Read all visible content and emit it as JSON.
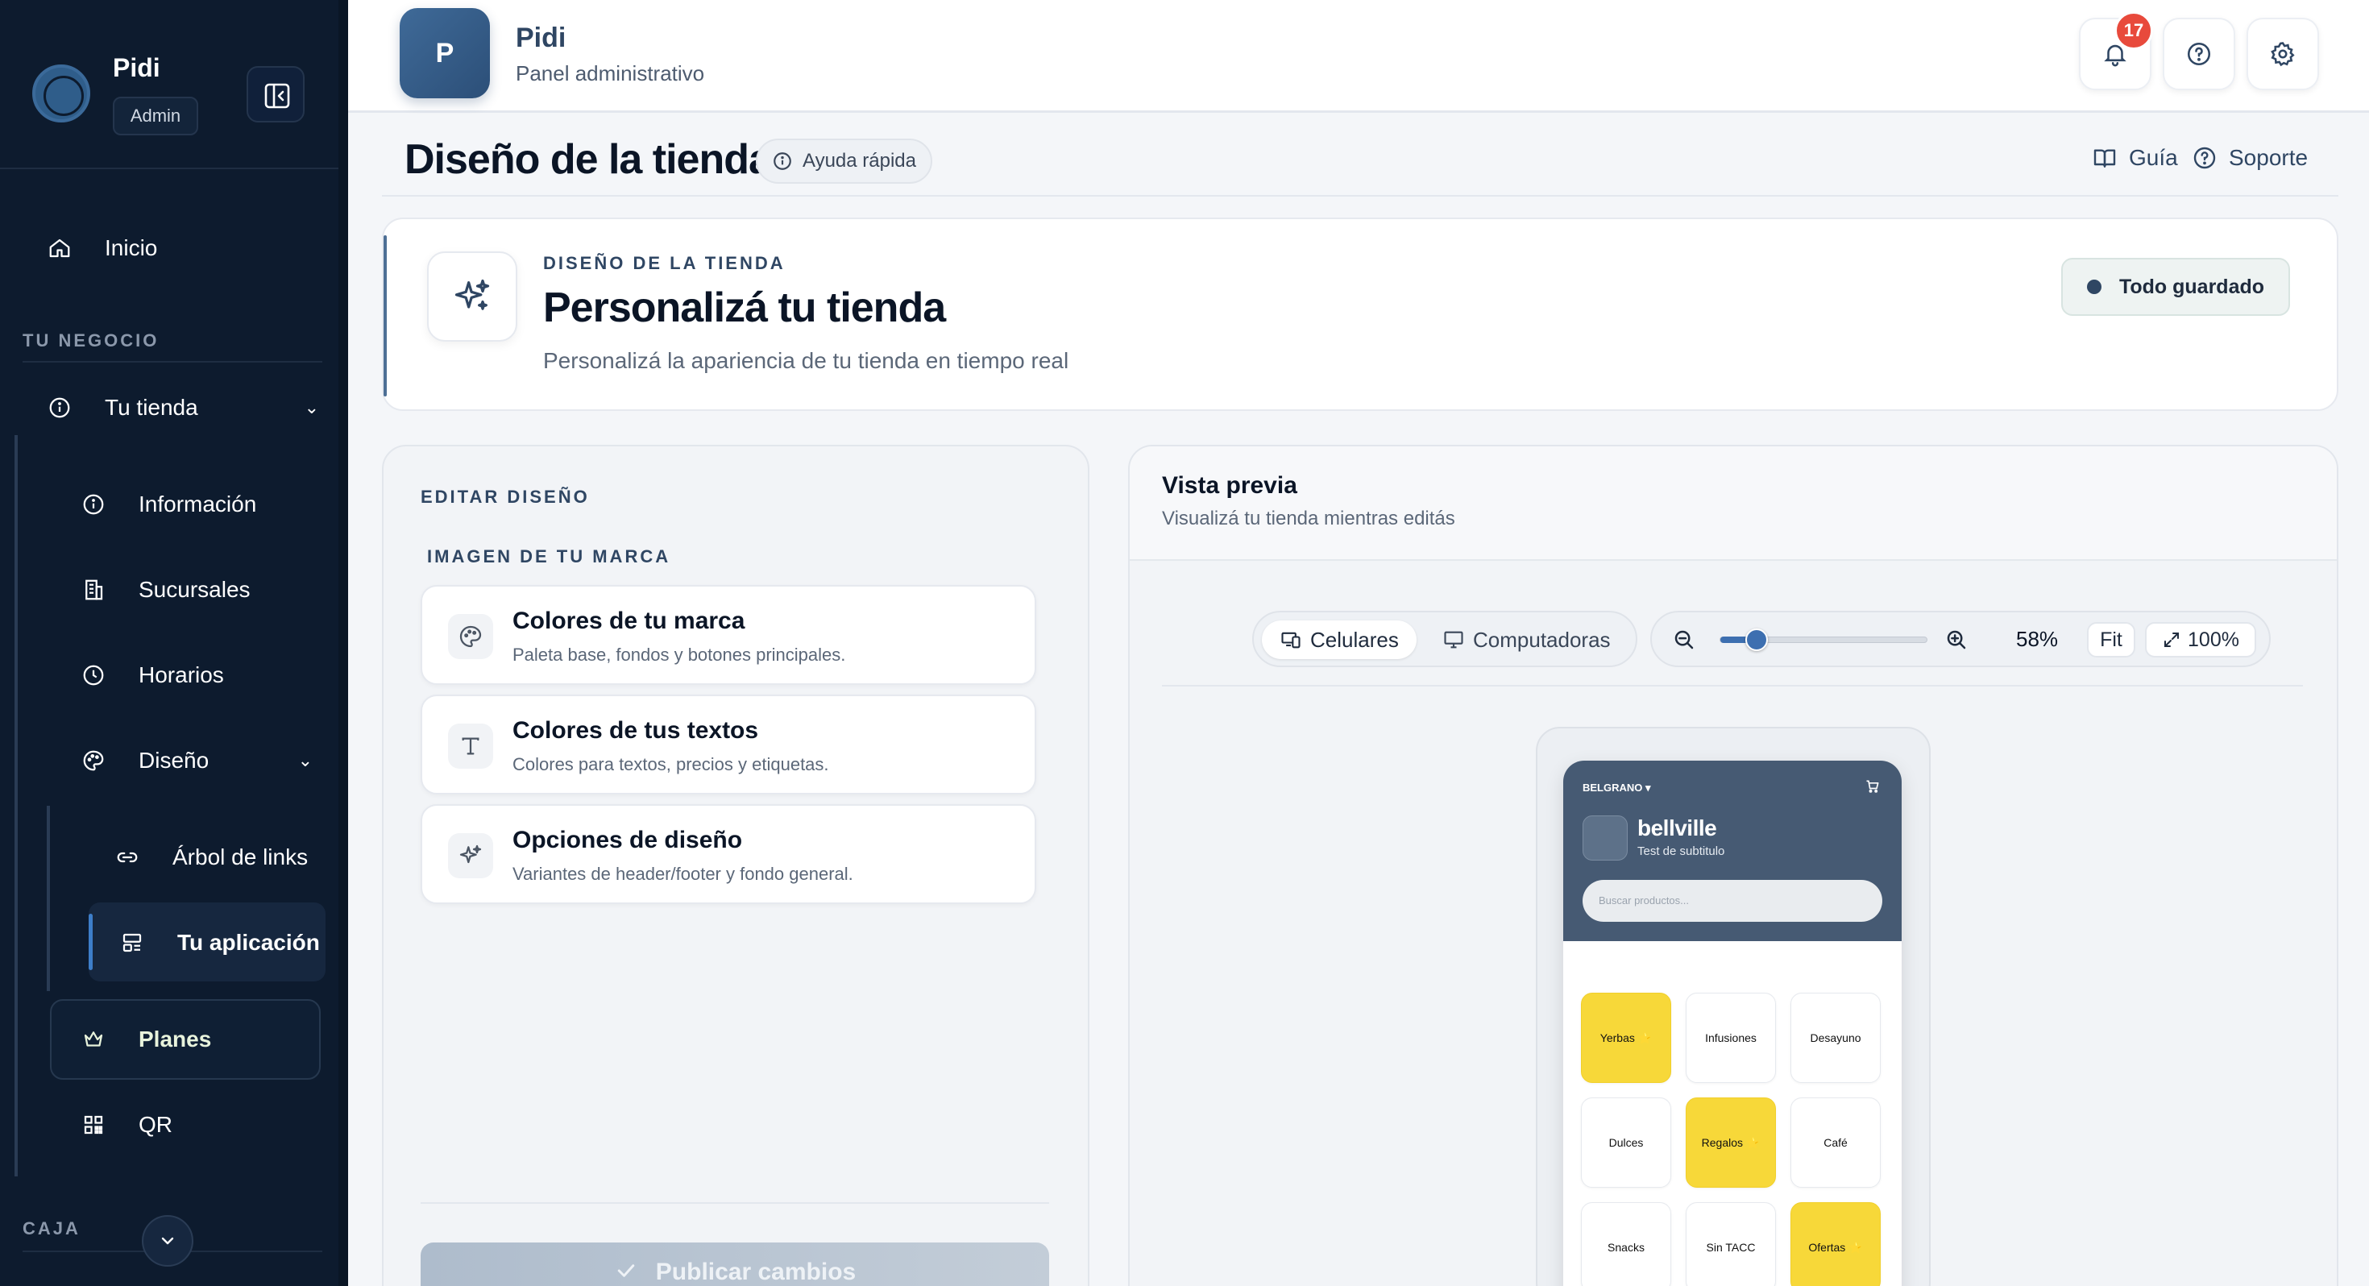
{
  "sidebar": {
    "user_name": "Pidi",
    "user_role": "Admin",
    "home_label": "Inicio",
    "section_business": "TU NEGOCIO",
    "store_label": "Tu tienda",
    "store_children": [
      "Información",
      "Sucursales",
      "Horarios"
    ],
    "design_label": "Diseño",
    "design_children": [
      "Árbol de links",
      "Tu aplicación"
    ],
    "plans_label": "Planes",
    "qr_label": "QR",
    "section_cash": "CAJA"
  },
  "header": {
    "logo_letter": "P",
    "title": "Pidi",
    "subtitle": "Panel administrativo",
    "notifications_count": "17"
  },
  "page": {
    "title": "Diseño de la tienda",
    "quick_help": "Ayuda rápida",
    "guide_link": "Guía",
    "support_link": "Soporte"
  },
  "hero": {
    "kicker": "DISEÑO DE LA TIENDA",
    "title": "Personalizá tu tienda",
    "subtitle": "Personalizá la apariencia de tu tienda en tiempo real",
    "status": "Todo guardado"
  },
  "editor": {
    "kicker": "EDITAR DISEÑO",
    "section": "IMAGEN DE TU MARCA",
    "options": [
      {
        "title": "Colores de tu marca",
        "subtitle": "Paleta base, fondos y botones principales.",
        "icon": "palette-icon"
      },
      {
        "title": "Colores de tus textos",
        "subtitle": "Colores para textos, precios y etiquetas.",
        "icon": "text-icon"
      },
      {
        "title": "Opciones de diseño",
        "subtitle": "Variantes de header/footer y fondo general.",
        "icon": "sparkles-icon"
      }
    ],
    "publish_label": "Publicar cambios"
  },
  "preview": {
    "title": "Vista previa",
    "subtitle": "Visualizá tu tienda mientras editás",
    "device_mobile": "Celulares",
    "device_desktop": "Computadoras",
    "zoom_percent": "58%",
    "zoom_level": 0.18,
    "fit_label": "Fit",
    "full_label": "100%"
  },
  "phone": {
    "branch": "BELGRANO ▾",
    "store_name": "bellville",
    "tagline": "Test de subtitulo",
    "search_placeholder": "Buscar productos...",
    "categories": [
      {
        "label": "Yerbas ⭐",
        "highlight": true
      },
      {
        "label": "Infusiones",
        "highlight": false
      },
      {
        "label": "Desayuno",
        "highlight": false
      },
      {
        "label": "Dulces",
        "highlight": false
      },
      {
        "label": "Regalos ⭐",
        "highlight": true
      },
      {
        "label": "Café",
        "highlight": false
      },
      {
        "label": "Snacks",
        "highlight": false
      },
      {
        "label": "Sin TACC",
        "highlight": false
      },
      {
        "label": "Ofertas ⭐",
        "highlight": true
      }
    ]
  },
  "colors": {
    "sidebar_bg": "#0d1b2e",
    "accent": "#3d6fb0",
    "brand_header": "#465a73",
    "highlight_yellow": "#f7d839",
    "badge_red": "#e84a3c"
  }
}
